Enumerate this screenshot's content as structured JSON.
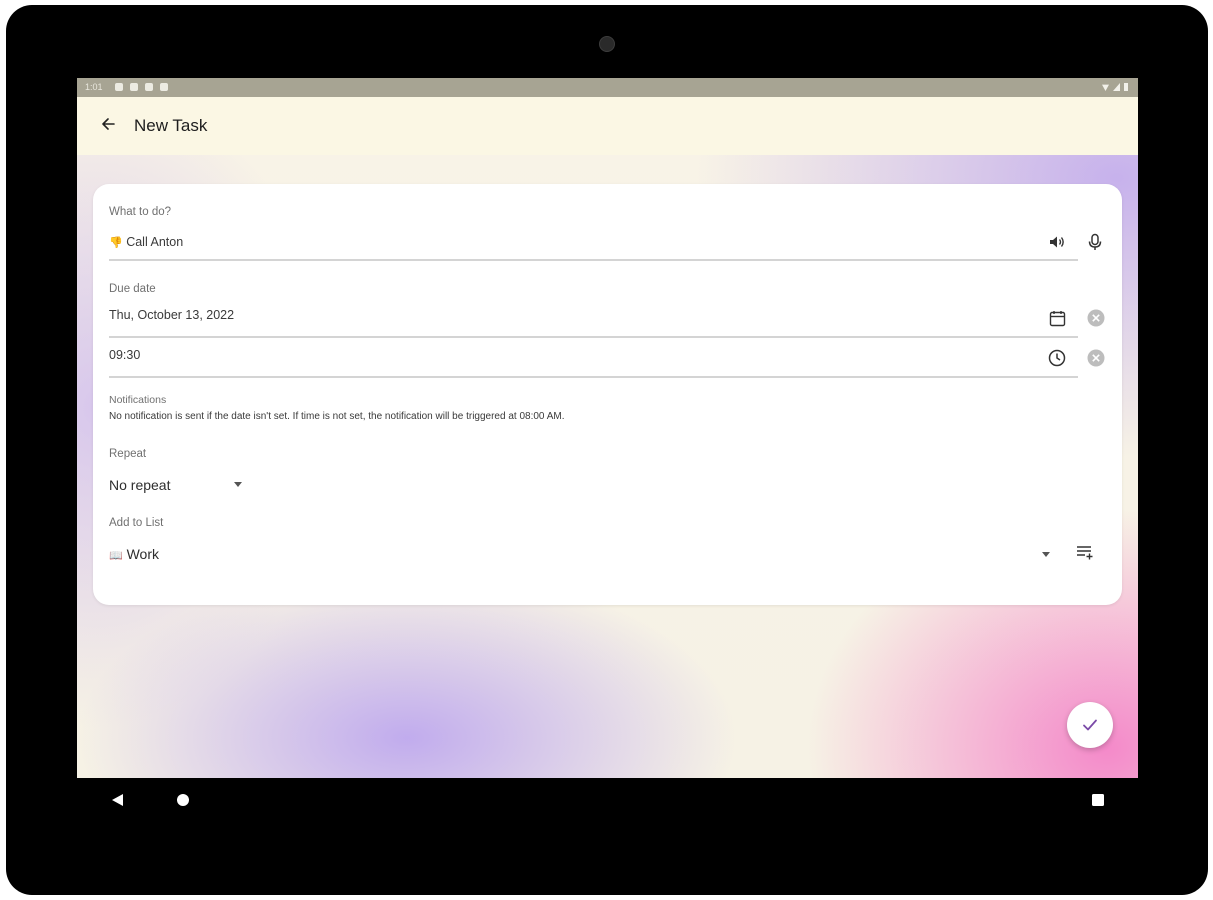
{
  "status_bar": {
    "time": "1:01"
  },
  "app_bar": {
    "title": "New Task",
    "back_icon": "arrow-back-icon"
  },
  "task_field": {
    "label": "What to do?",
    "emoji": "👎",
    "value": "Call Anton",
    "speak_icon": "volume-up-icon",
    "mic_icon": "microphone-icon"
  },
  "due_date": {
    "label": "Due date",
    "date_value": "Thu, October 13, 2022",
    "time_value": "09:30",
    "calendar_icon": "calendar-icon",
    "clock_icon": "clock-icon",
    "clear_icon": "clear-circle-icon"
  },
  "notifications": {
    "label": "Notifications",
    "text": "No notification is sent if the date isn't set. If time is not set, the notification will be triggered at 08:00 AM."
  },
  "repeat": {
    "label": "Repeat",
    "selected": "No repeat"
  },
  "list": {
    "label": "Add to List",
    "emoji": "📖",
    "selected": "Work",
    "manage_icon": "playlist-add-icon"
  },
  "fab": {
    "icon": "check-icon"
  },
  "nav_bar": {
    "back_icon": "nav-back-triangle-icon",
    "home_icon": "nav-home-circle-icon",
    "recents_icon": "nav-recents-square-icon"
  },
  "colors": {
    "app_bar_bg": "#fbf7e4",
    "status_bar_bg": "#a7a493",
    "card_bg": "#ffffff",
    "accent": "#7b4aa8"
  }
}
